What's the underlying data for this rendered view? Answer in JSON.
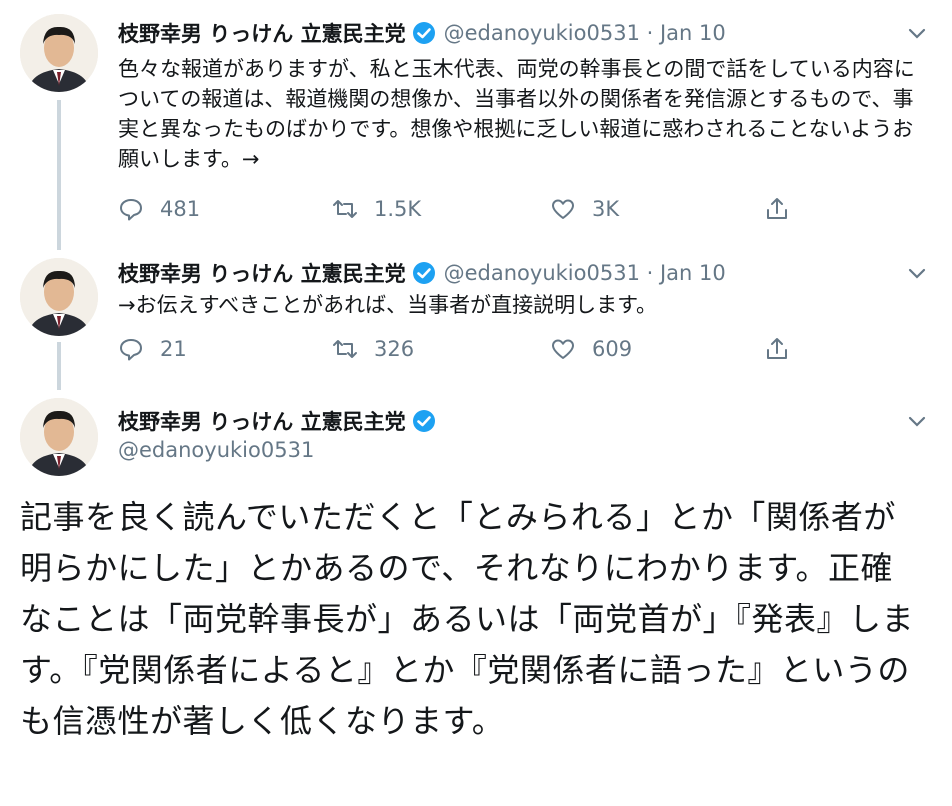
{
  "user": {
    "display_name": "枝野幸男 りっけん 立憲民主党",
    "handle": "@edanoyukio0531",
    "verified_icon": "verified-badge-icon"
  },
  "colors": {
    "text": "#14171a",
    "muted": "#657786",
    "verified": "#1da1f2",
    "line": "#ccd6dd"
  },
  "tweets": [
    {
      "meta": "@edanoyukio0531 · Jan 10",
      "text": "色々な報道がありますが、私と玉木代表、両党の幹事長との間で話をしている内容についての報道は、報道機関の想像か、当事者以外の関係者を発信源とするもので、事実と異なったものばかりです。想像や根拠に乏しい報道に惑わされることないようお願いします。→",
      "replies": "481",
      "retweets": "1.5K",
      "likes": "3K"
    },
    {
      "meta": "@edanoyukio0531 · Jan 10",
      "text": "→お伝えすべきことがあれば、当事者が直接説明します。",
      "replies": "21",
      "retweets": "326",
      "likes": "609"
    }
  ],
  "main_tweet": {
    "handle": "@edanoyukio0531",
    "text": "記事を良く読んでいただくと「とみられる」とか「関係者が明らかにした」とかあるので、それなりにわかります。正確なことは「両党幹事長が」あるいは「両党首が」『発表』します。『党関係者によると』とか『党関係者に語った』というのも信憑性が著しく低くなります。"
  }
}
